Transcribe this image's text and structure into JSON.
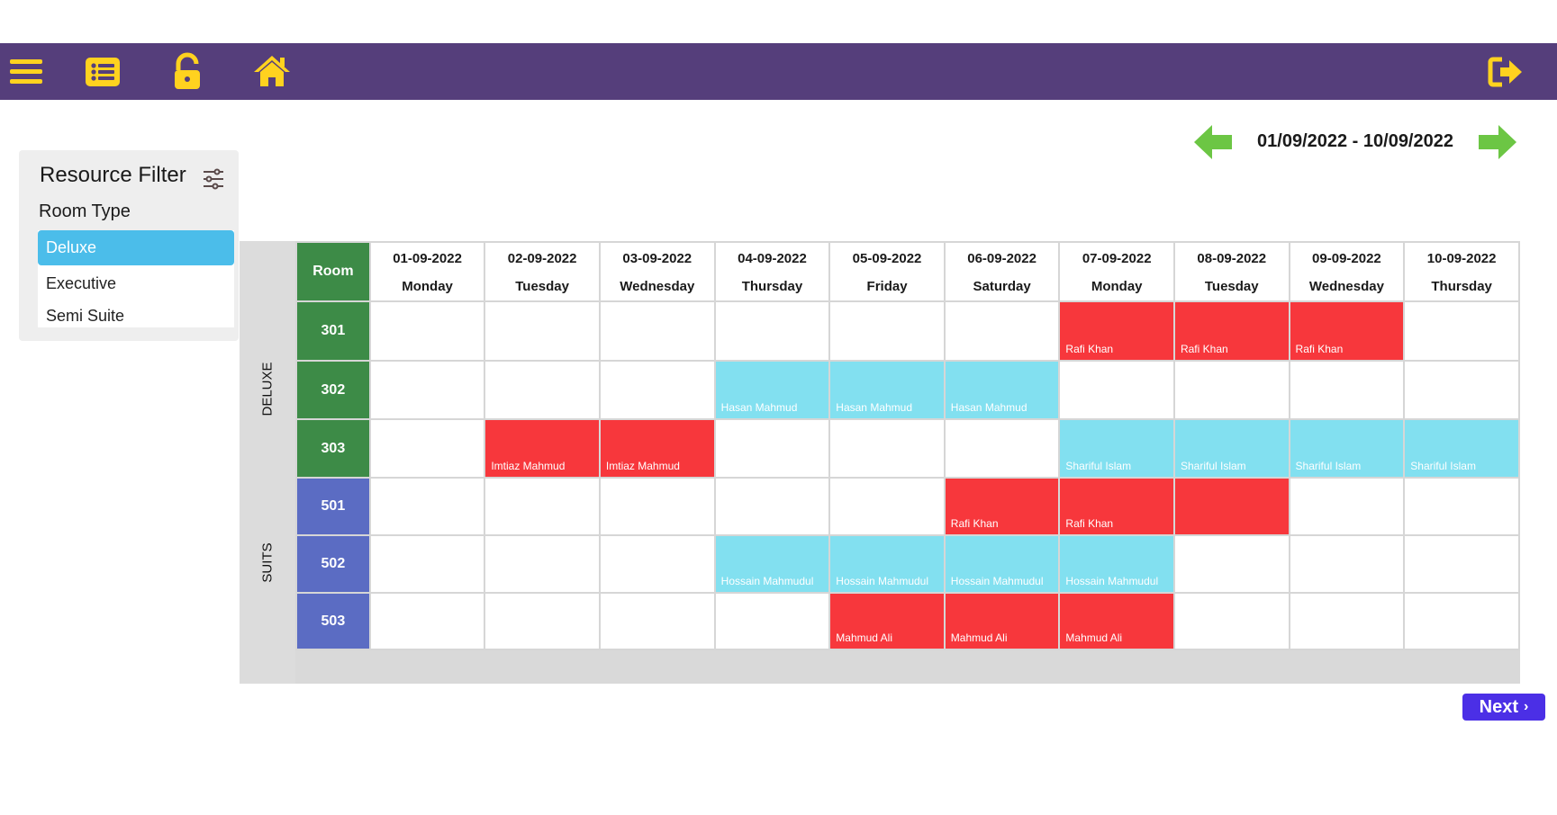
{
  "toolbar": {
    "icons": [
      "hamburger-menu-icon",
      "list-icon",
      "unlock-icon",
      "home-icon"
    ],
    "logout_icon": "logout-icon",
    "bg_color": "#553e7b",
    "icon_color": "#ffd21f"
  },
  "filter": {
    "title": "Resource Filter",
    "subtitle": "Room Type",
    "options": [
      {
        "label": "Deluxe",
        "selected": true
      },
      {
        "label": "Executive",
        "selected": false
      },
      {
        "label": "Semi Suite",
        "selected": false
      }
    ]
  },
  "date_nav": {
    "range": "01/09/2022 - 10/09/2022",
    "arrow_color": "#6cc644"
  },
  "scheduler": {
    "room_header": "Room",
    "dates": [
      {
        "date": "01-09-2022",
        "day": "Monday"
      },
      {
        "date": "02-09-2022",
        "day": "Tuesday"
      },
      {
        "date": "03-09-2022",
        "day": "Wednesday"
      },
      {
        "date": "04-09-2022",
        "day": "Thursday"
      },
      {
        "date": "05-09-2022",
        "day": "Friday"
      },
      {
        "date": "06-09-2022",
        "day": "Saturday"
      },
      {
        "date": "07-09-2022",
        "day": "Monday"
      },
      {
        "date": "08-09-2022",
        "day": "Tuesday"
      },
      {
        "date": "09-09-2022",
        "day": "Wednesday"
      },
      {
        "date": "10-09-2022",
        "day": "Thursday"
      }
    ],
    "groups": [
      {
        "label": "DELUXE",
        "color": "#3d8b47",
        "rooms": [
          {
            "room": "301",
            "cells": [
              null,
              null,
              null,
              null,
              null,
              null,
              {
                "status": "red",
                "guest": "Rafi Khan"
              },
              {
                "status": "red",
                "guest": "Rafi Khan"
              },
              {
                "status": "red",
                "guest": "Rafi Khan"
              },
              null
            ]
          },
          {
            "room": "302",
            "cells": [
              null,
              null,
              null,
              {
                "status": "cyan",
                "guest": "Hasan Mahmud"
              },
              {
                "status": "cyan",
                "guest": "Hasan Mahmud"
              },
              {
                "status": "cyan",
                "guest": "Hasan Mahmud"
              },
              null,
              null,
              null,
              null
            ]
          },
          {
            "room": "303",
            "cells": [
              null,
              {
                "status": "red",
                "guest": "Imtiaz Mahmud"
              },
              {
                "status": "red",
                "guest": "Imtiaz Mahmud"
              },
              null,
              null,
              null,
              {
                "status": "cyan",
                "guest": "Shariful Islam"
              },
              {
                "status": "cyan",
                "guest": "Shariful Islam"
              },
              {
                "status": "cyan",
                "guest": "Shariful Islam"
              },
              {
                "status": "cyan",
                "guest": "Shariful Islam"
              }
            ]
          }
        ]
      },
      {
        "label": "SUITS",
        "color": "#5b6cc3",
        "rooms": [
          {
            "room": "501",
            "cells": [
              null,
              null,
              null,
              null,
              null,
              {
                "status": "red",
                "guest": "Rafi Khan"
              },
              {
                "status": "red",
                "guest": "Rafi Khan"
              },
              {
                "status": "red",
                "guest": ""
              },
              null,
              null
            ]
          },
          {
            "room": "502",
            "cells": [
              null,
              null,
              null,
              {
                "status": "cyan",
                "guest": "Hossain Mahmudul"
              },
              {
                "status": "cyan",
                "guest": "Hossain Mahmudul"
              },
              {
                "status": "cyan",
                "guest": "Hossain Mahmudul"
              },
              {
                "status": "cyan",
                "guest": "Hossain Mahmudul"
              },
              null,
              null,
              null
            ]
          },
          {
            "room": "503",
            "cells": [
              null,
              null,
              null,
              null,
              {
                "status": "red",
                "guest": "Mahmud Ali"
              },
              {
                "status": "red",
                "guest": "Mahmud Ali"
              },
              {
                "status": "red",
                "guest": "Mahmud Ali"
              },
              null,
              null,
              null
            ]
          }
        ]
      }
    ],
    "status_colors": {
      "red": "#f7373c",
      "cyan": "#82e0f0"
    }
  },
  "pager": {
    "next_label": "Next"
  }
}
